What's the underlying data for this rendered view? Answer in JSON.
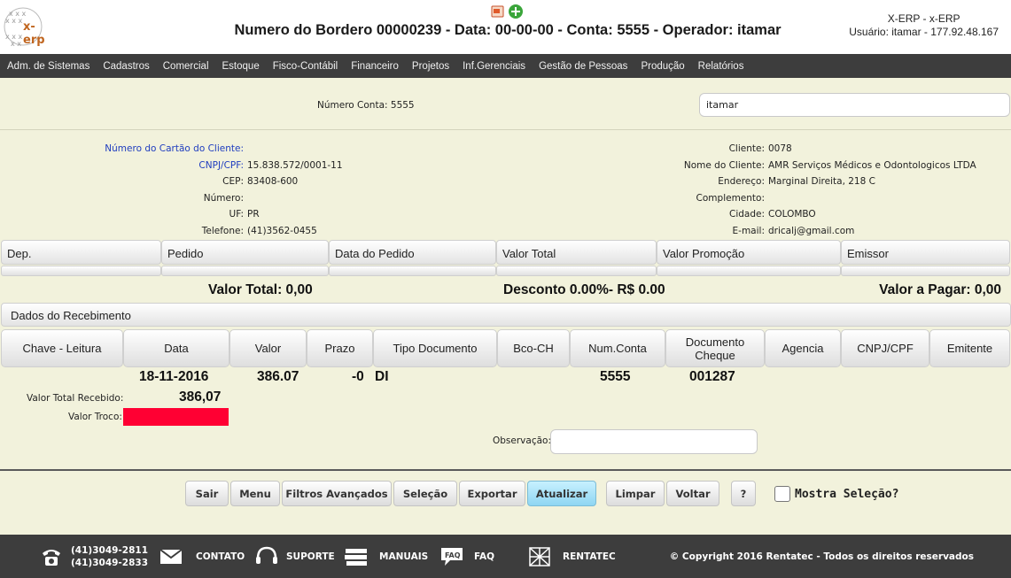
{
  "header": {
    "logo_text": "x-erp",
    "title": "Numero do Bordero 00000239 - Data: 00-00-00 - Conta: 5555 - Operador: itamar",
    "system_name": "X-ERP - x-ERP",
    "user_info": "Usuário: itamar - 177.92.48.167"
  },
  "menu": {
    "items": [
      "Adm. de Sistemas",
      "Cadastros",
      "Comercial",
      "Estoque",
      "Fisco-Contábil",
      "Financeiro",
      "Projetos",
      "Inf.Gerenciais",
      "Gestão de Pessoas",
      "Produção",
      "Relatórios"
    ]
  },
  "conta": {
    "label": "Número Conta: 5555",
    "operador_value": "itamar"
  },
  "cliente_left": [
    {
      "label": "Número do Cartão do Cliente:",
      "value": "",
      "blue": true
    },
    {
      "label": "CNPJ/CPF:",
      "value": "15.838.572/0001-11",
      "blue": true
    },
    {
      "label": "CEP:",
      "value": "83408-600",
      "blue": false
    },
    {
      "label": "Número:",
      "value": "",
      "blue": false
    },
    {
      "label": "UF:",
      "value": "PR",
      "blue": false
    },
    {
      "label": "Telefone:",
      "value": "(41)3562-0455",
      "blue": false
    }
  ],
  "cliente_right": [
    {
      "label": "Cliente:",
      "value": "0078"
    },
    {
      "label": "Nome do Cliente:",
      "value": "AMR Serviços Médicos e Odontologicos LTDA"
    },
    {
      "label": "Endereço:",
      "value": "Marginal Direita, 218 C"
    },
    {
      "label": "Complemento:",
      "value": ""
    },
    {
      "label": "Cidade:",
      "value": "COLOMBO"
    },
    {
      "label": "E-mail:",
      "value": "dricalj@gmail.com"
    }
  ],
  "pedidos_columns": [
    "Dep.",
    "Pedido",
    "Data do Pedido",
    "Valor Total",
    "Valor Promoção",
    "Emissor"
  ],
  "totals": {
    "valor_total": "Valor Total: 0,00",
    "desconto": "Desconto 0.00%- R$ 0.00",
    "valor_pagar": "Valor a Pagar: 0,00"
  },
  "recebimento": {
    "section_title": "Dados do Recebimento",
    "columns": [
      "Chave - Leitura",
      "Data",
      "Valor",
      "Prazo",
      "Tipo Documento",
      "Bco-CH",
      "Num.Conta",
      "Documento Cheque",
      "Agencia",
      "CNPJ/CPF",
      "Emitente"
    ],
    "row": {
      "data": "18-11-2016",
      "valor": "386.07",
      "prazo": "-0",
      "tipo": "DI",
      "num_conta": "5555",
      "documento": "001287"
    },
    "valor_total_label": "Valor Total Recebido:",
    "valor_total_value": "386,07",
    "valor_troco_label": "Valor Troco:",
    "observacao_label": "Observação:"
  },
  "buttons": {
    "sair": "Sair",
    "menu": "Menu",
    "filtros": "Filtros Avançados",
    "selecao": "Seleção",
    "exportar": "Exportar",
    "atualizar": "Atualizar",
    "limpar": "Limpar",
    "voltar": "Voltar",
    "help": "?",
    "mostra_selecao": "Mostra Seleção?"
  },
  "footer": {
    "phone1": "(41)3049-2811",
    "phone2": "(41)3049-2833",
    "contato": "CONTATO",
    "suporte": "SUPORTE",
    "manuais": "MANUAIS",
    "faq": "FAQ",
    "rentatec": "RENTATEC",
    "copyright": "© Copyright 2016 Rentatec - Todos os direitos reservados"
  },
  "colors": {
    "background": "#f2f2dc",
    "menubar": "#3d3d3d",
    "troco_alert": "#ff0033",
    "active_button": "#8fd6f2",
    "link_blue": "#1f3dbf"
  }
}
